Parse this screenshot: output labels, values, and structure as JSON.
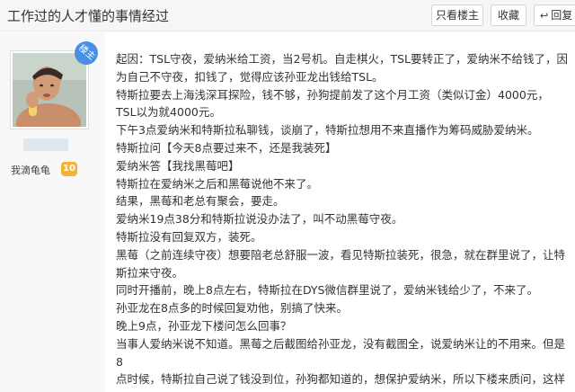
{
  "header": {
    "title": "工作过的人才懂的事情经过",
    "only_louzhu_label": "只看楼主",
    "favorite_label": "收藏",
    "reply_label": "回复"
  },
  "author": {
    "louzhu_badge": "楼主",
    "level_name": "我滴龟龟",
    "level_number": "10"
  },
  "post": {
    "lines": [
      "起因：TSL守夜，爱纳米给工资，当2号机。自走棋火，TSL要转正了，爱纳米不给钱了，因",
      "为自己不守夜，扣钱了，觉得应该孙亚龙出钱给TSL。",
      "特斯拉要去上海浅深耳探险，钱不够，孙狗提前发了这个月工资（类似订金）4000元，",
      "TSL以为就4000元。",
      "下午3点爱纳米和特斯拉私聊钱，谈崩了，特斯拉想用不来直播作为筹码威胁爱纳米。",
      "特斯拉问【今天8点要过来不，还是我装死】",
      "爱纳米答【我找黑莓吧】",
      "特斯拉在爱纳米之后和黑莓说他不来了。",
      "结果，黑莓和老总有聚会，要走。",
      "爱纳米19点38分和特斯拉说没办法了，叫不动黑莓守夜。",
      "特斯拉没有回复双方，装死。",
      "黑莓（之前连续守夜）想要陪老总舒服一波，看见特斯拉装死，很急，就在群里说了，让特",
      "斯拉来守夜。",
      "同时开播前，晚上8点左右，特斯拉在DYS微信群里说了，爱纳米钱给少了，不来了。",
      "孙亚龙在8点多的时候回复劝他，别搞了快来。",
      "晚上9点，孙亚龙下楼问怎么回事？",
      "当事人爱纳米说不知道。黑莓之后截图给孙亚龙，没有截图全，说爱纳米让的不用来。但是8",
      "点时候，特斯拉自己说了钱没到位，孙狗都知道的，想保护爱纳米，所以下楼来质问，这样"
    ]
  }
}
